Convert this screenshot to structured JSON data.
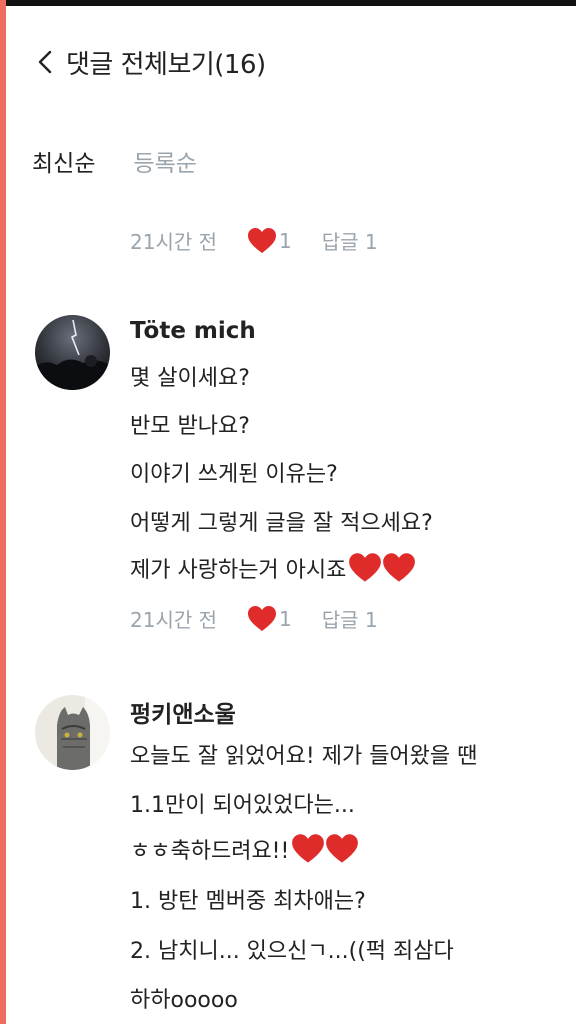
{
  "header": {
    "back_icon": "chevron-left-icon",
    "title": "댓글 전체보기(16)"
  },
  "sort_tabs": {
    "latest": "최신순",
    "registered": "등록순"
  },
  "top_meta": {
    "time": "21시간 전",
    "likes": "1",
    "reply": "답글 1"
  },
  "comments": [
    {
      "author": "Töte mich",
      "lines": [
        "몇 살이세요?",
        "반모 받나요?",
        "이야기 쓰게된 이유는?",
        "어떻게 그렇게 글을 잘 적으세요?",
        "제가 사랑하는거 아시죠"
      ],
      "time": "21시간 전",
      "likes": "1",
      "reply": "답글 1"
    },
    {
      "author": "펑키앤소울",
      "lines": [
        "오늘도 잘 읽었어요! 제가 들어왔을 땐",
        "1.1만이 되어있었다는...",
        "ㅎㅎ축하드려요!!",
        "1. 방탄 멤버중 최차애는?",
        "2. 남치니... 있으신ㄱ...((퍽 죄삼다",
        "하하ooooo"
      ]
    }
  ],
  "colors": {
    "accent_edge": "#ef6c60",
    "heart": "#e02b2b",
    "muted": "#9aa4ad"
  }
}
